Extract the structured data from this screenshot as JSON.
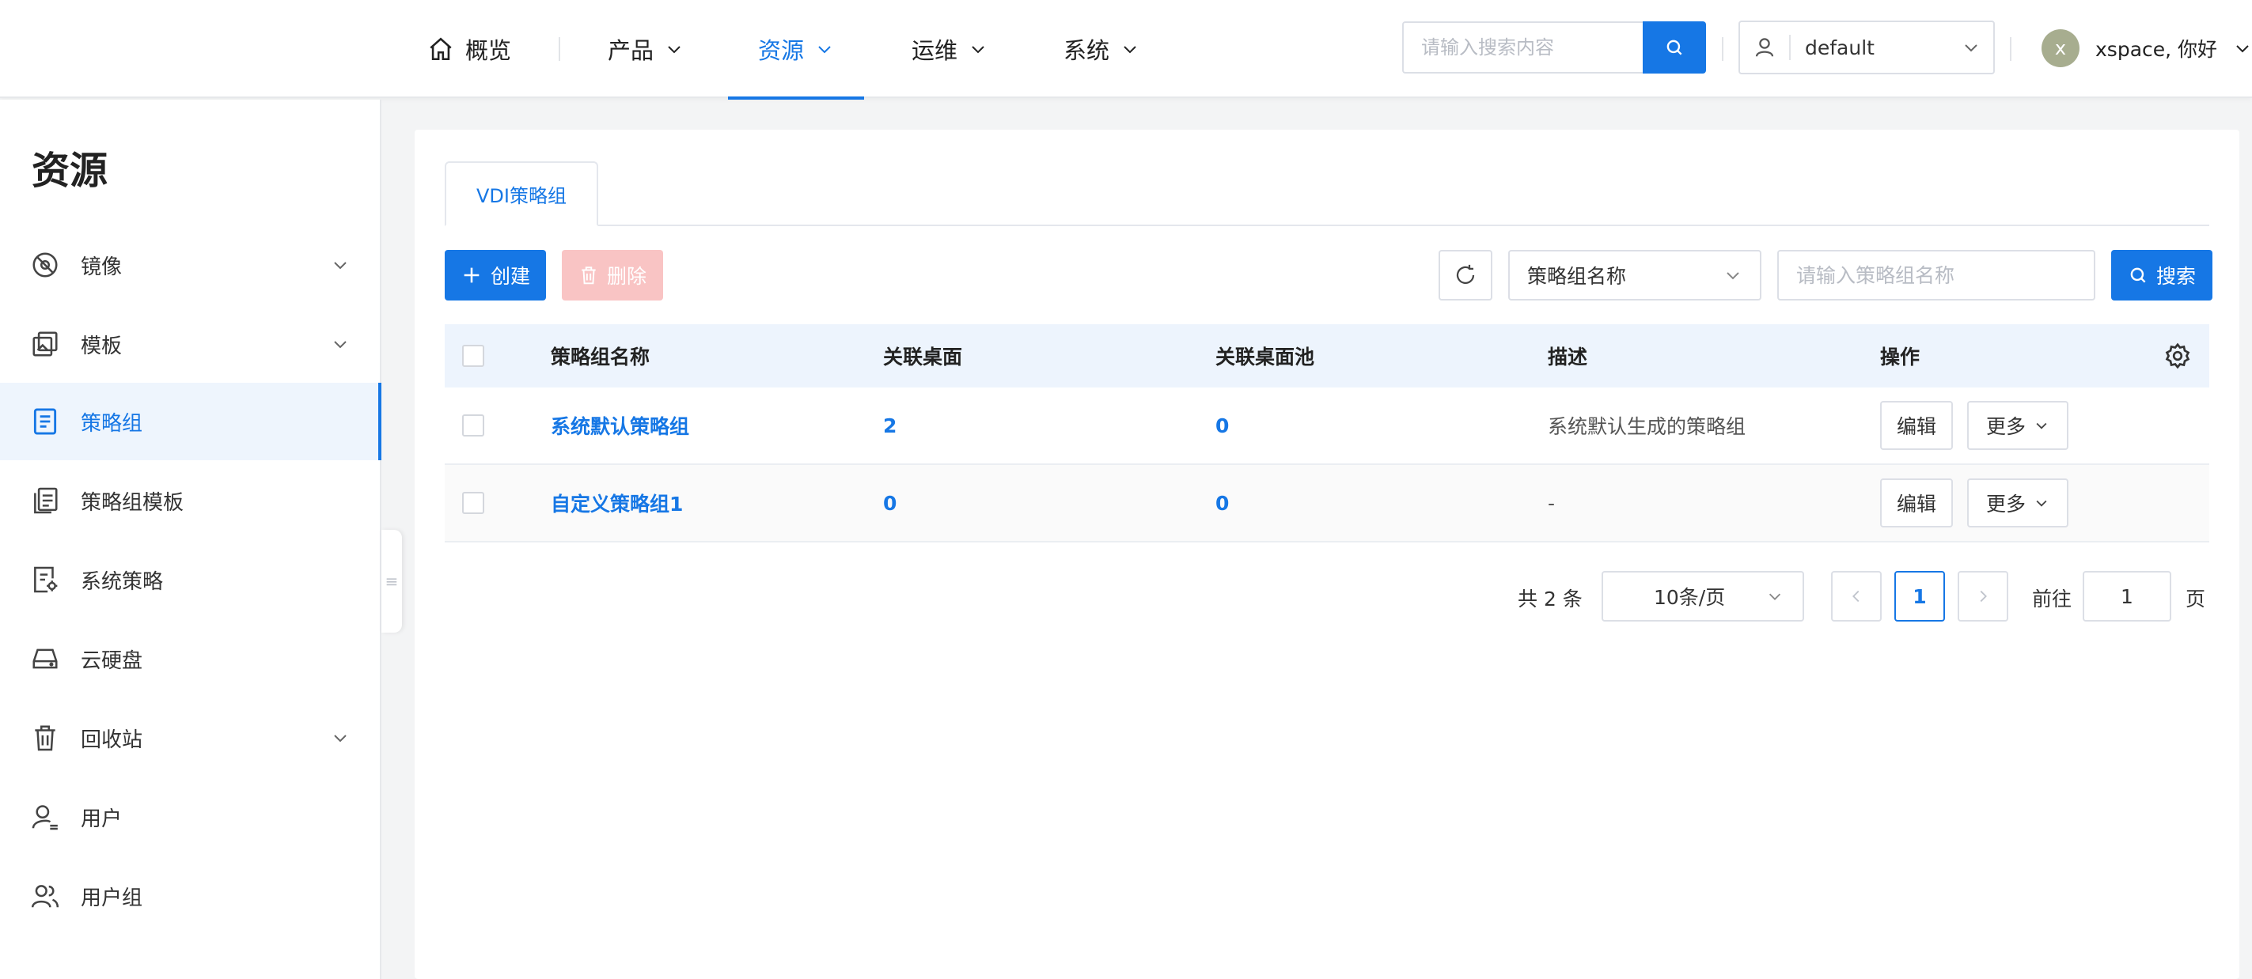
{
  "nav": {
    "items": [
      {
        "label": "概览",
        "icon": "home-icon"
      },
      {
        "label": "产品"
      },
      {
        "label": "资源"
      },
      {
        "label": "运维"
      },
      {
        "label": "系统"
      }
    ],
    "active": "资源",
    "search_placeholder": "请输入搜索内容",
    "tenant": "default",
    "user_initial": "x",
    "user_greeting": "xspace, 你好"
  },
  "sidebar": {
    "title": "资源",
    "items": [
      {
        "label": "镜像",
        "icon": "disc-icon",
        "expandable": true
      },
      {
        "label": "模板",
        "icon": "template-icon",
        "expandable": true
      },
      {
        "label": "策略组",
        "icon": "document-icon",
        "active": true
      },
      {
        "label": "策略组模板",
        "icon": "documents-icon"
      },
      {
        "label": "系统策略",
        "icon": "settings-doc-icon"
      },
      {
        "label": "云硬盘",
        "icon": "disk-icon"
      },
      {
        "label": "回收站",
        "icon": "trash-icon",
        "expandable": true
      },
      {
        "label": "用户",
        "icon": "user-icon"
      },
      {
        "label": "用户组",
        "icon": "users-icon"
      }
    ]
  },
  "main": {
    "tab": "VDI策略组",
    "toolbar": {
      "create_label": "创建",
      "delete_label": "删除",
      "filter_field": "策略组名称",
      "filter_placeholder": "请输入策略组名称",
      "search_label": "搜索"
    },
    "table": {
      "headers": [
        "策略组名称",
        "关联桌面",
        "关联桌面池",
        "描述",
        "操作"
      ],
      "rows": [
        {
          "name": "系统默认策略组",
          "desktops": "2",
          "pools": "0",
          "desc": "系统默认生成的策略组"
        },
        {
          "name": "自定义策略组1",
          "desktops": "0",
          "pools": "0",
          "desc": "-"
        }
      ],
      "edit_label": "编辑",
      "more_label": "更多"
    },
    "pagination": {
      "total": "共 2 条",
      "page_size": "10条/页",
      "current": "1",
      "goto_label": "前往",
      "goto_value": "1",
      "page_unit": "页"
    }
  },
  "colors": {
    "primary": "#1677e5",
    "danger_disabled": "#f9c4c4",
    "table_header_bg": "#edf4fd"
  }
}
